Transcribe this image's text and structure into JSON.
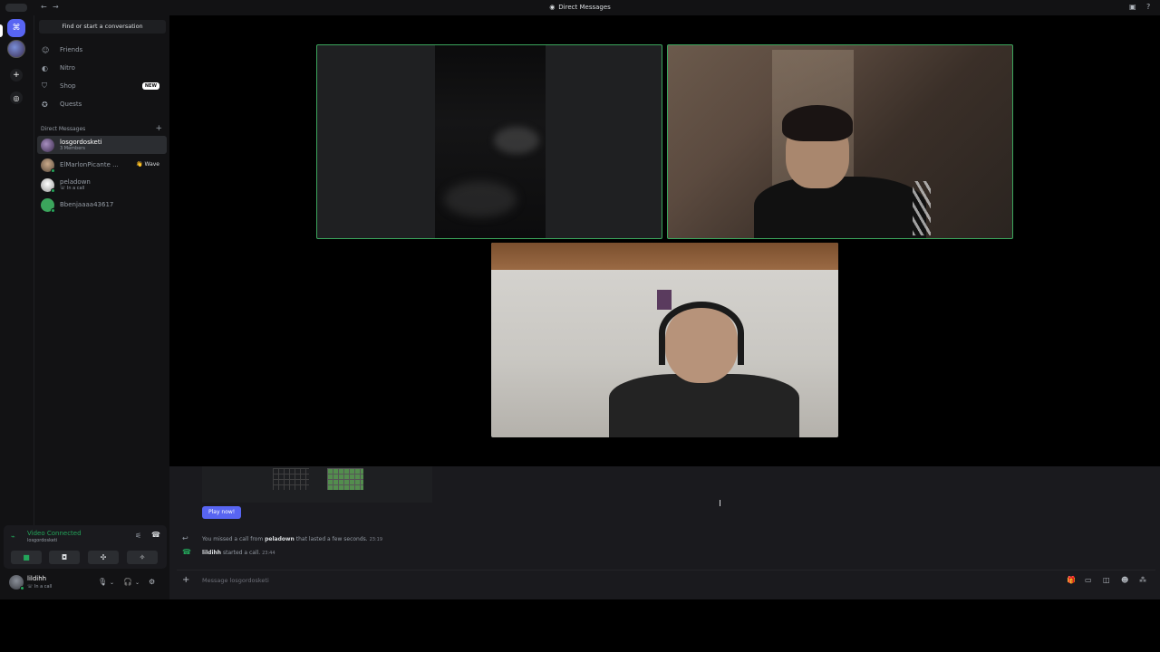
{
  "titlebar": {
    "title": "Direct Messages",
    "discord_icon": "discord-icon",
    "back": "←",
    "forward": "→",
    "inbox": "▣",
    "help": "?"
  },
  "rail": {
    "home_icon": "⌘",
    "add_icon": "+",
    "discover_icon": "◎"
  },
  "sidebar": {
    "find_label": "Find or start a conversation",
    "nav": [
      {
        "label": "Friends",
        "icon": "☺"
      },
      {
        "label": "Nitro",
        "icon": "◐"
      },
      {
        "label": "Shop",
        "icon": "⛉",
        "badge": "NEW"
      },
      {
        "label": "Quests",
        "icon": "✪"
      }
    ],
    "dm_header": "Direct Messages",
    "dm_add": "+",
    "dms": [
      {
        "name": "losgordosketi",
        "sub": "3 Members"
      },
      {
        "name": "ElMarlonPicante ...",
        "sub": "",
        "action": "👋 Wave"
      },
      {
        "name": "peladown",
        "sub": "☏ In a call"
      },
      {
        "name": "Bbenjaaaa43617",
        "sub": ""
      }
    ]
  },
  "voice": {
    "status": "Video Connected",
    "channel": "losgordosketi",
    "signal_icon": "⌁",
    "noise_icon": "⚟",
    "disconnect_icon": "☎",
    "buttons": [
      "■",
      "◘",
      "✣",
      "✧"
    ]
  },
  "user": {
    "name": "lildihh",
    "status": "☏ In a call",
    "mic_icon": "🎙",
    "headset_icon": "🎧",
    "settings_icon": "⚙",
    "caret": "⌄"
  },
  "chat": {
    "play_now": "Play now!",
    "missed": {
      "prefix": "You missed a call from",
      "who": "peladown",
      "suffix": "that lasted a few seconds.",
      "time": "23:19"
    },
    "started": {
      "who": "lildihh",
      "text": "started a call.",
      "time": "23:44"
    },
    "composer_placeholder": "Message losgordosketi",
    "composer_plus": "+",
    "composer_icons": [
      "🎁",
      "▭",
      "◫",
      "☻",
      "⁂"
    ],
    "cursor_glyph": "I"
  },
  "colors": {
    "accent": "#5865f2",
    "speaking": "#3ba55c",
    "online": "#23a55a"
  }
}
